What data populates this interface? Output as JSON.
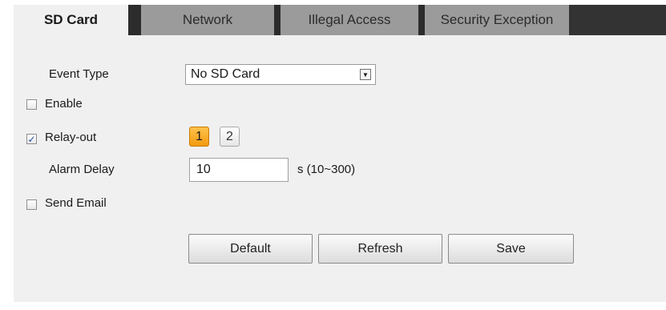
{
  "tabs": [
    "SD Card",
    "Network",
    "Illegal Access",
    "Security Exception"
  ],
  "form": {
    "event_type_label": "Event Type",
    "event_type_value": "No SD Card",
    "enable_label": "Enable",
    "enable_checked": false,
    "relay_label": "Relay-out",
    "relay_checked": true,
    "relay_options": [
      "1",
      "2"
    ],
    "relay_selected": "1",
    "alarm_delay_label": "Alarm Delay",
    "alarm_delay_value": "10",
    "alarm_delay_hint": "s (10~300)",
    "send_email_label": "Send Email",
    "send_email_checked": false
  },
  "buttons": {
    "default": "Default",
    "refresh": "Refresh",
    "save": "Save"
  },
  "colors": {
    "selected_relay": "#f5a623",
    "tab_inactive": "#9b9b9b",
    "tab_divider": "#2c2c2c"
  },
  "icons": {
    "check": "✓",
    "dropdown": "▼"
  }
}
